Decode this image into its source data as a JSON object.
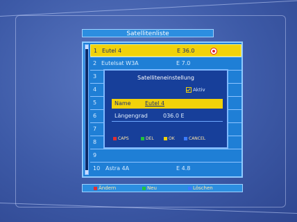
{
  "title": "Satellitenliste",
  "list": [
    {
      "num": "1",
      "name": "Eutel 4",
      "pos": "E 36.0"
    },
    {
      "num": "2",
      "name": "Eutelsat W3A",
      "pos": "E 7.0"
    },
    {
      "num": "3",
      "name": "",
      "pos": ""
    },
    {
      "num": "4",
      "name": "",
      "pos": ""
    },
    {
      "num": "5",
      "name": "",
      "pos": ""
    },
    {
      "num": "6",
      "name": "",
      "pos": ""
    },
    {
      "num": "7",
      "name": "",
      "pos": ""
    },
    {
      "num": "8",
      "name": "",
      "pos": ""
    },
    {
      "num": "9",
      "name": "",
      "pos": ""
    },
    {
      "num": "10",
      "name": "Astra 4A",
      "pos": "E 4.8"
    }
  ],
  "dialog": {
    "title": "Satelliteneinstellung",
    "checkbox_label": "Aktiv",
    "name_label": "Name",
    "name_value": "Eutel 4",
    "long_label": "Längengrad",
    "long_value": "036.0 E",
    "keys": [
      {
        "label": "CAPS",
        "color": "#e03030"
      },
      {
        "label": "DEL",
        "color": "#21c43a"
      },
      {
        "label": "OK",
        "color": "#f1d20a"
      },
      {
        "label": "CANCEL",
        "color": "#3a7bff"
      }
    ]
  },
  "hints": [
    {
      "label": "Ändern",
      "color": "#e03030"
    },
    {
      "label": "Neu",
      "color": "#21c43a"
    },
    {
      "label": "Löschen",
      "color": "#3a7bff"
    }
  ],
  "colors": {
    "selection": "#f1d20a",
    "panel": "#1f7fd6",
    "background": "#3d5aa7"
  }
}
